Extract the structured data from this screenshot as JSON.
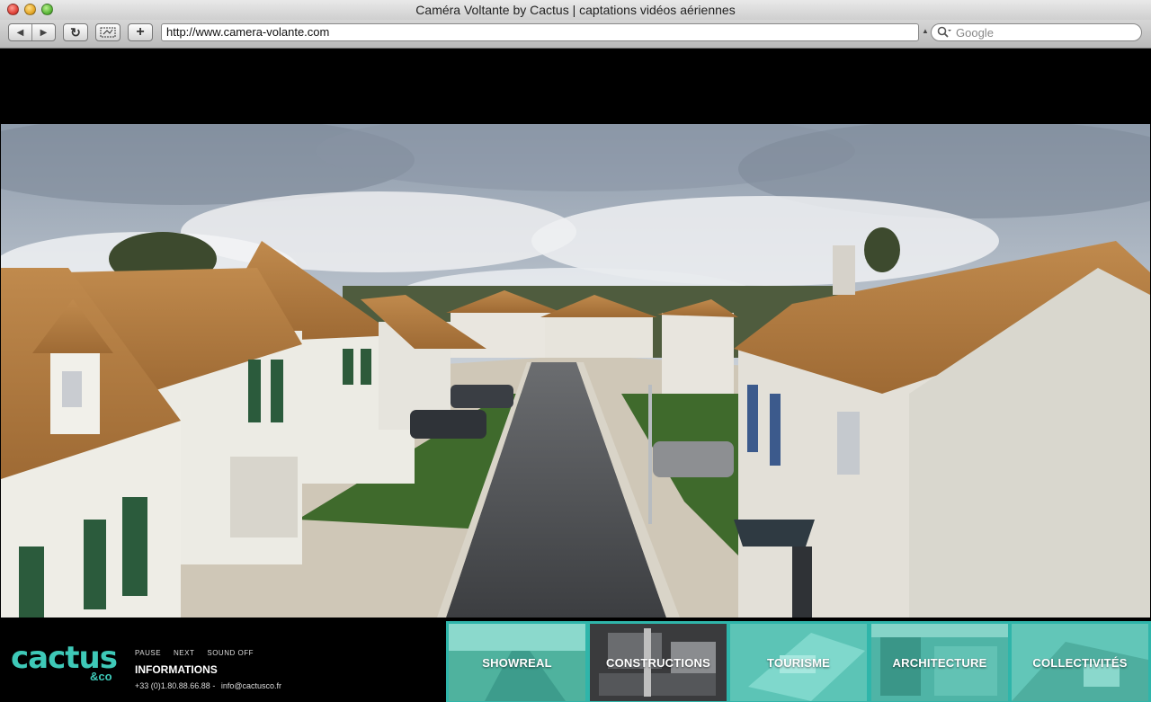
{
  "window": {
    "title": "Caméra Voltante by Cactus | captations vidéos aériennes"
  },
  "toolbar": {
    "back_icon": "◀",
    "forward_icon": "▶",
    "reload_icon": "↻",
    "add_icon": "+",
    "url": "http://www.camera-volante.com",
    "search_placeholder": "Google"
  },
  "brand": {
    "name": "cactus",
    "suffix": "&co",
    "color": "#3ec9b8"
  },
  "controls": {
    "pause": "PAUSE",
    "next": "NEXT",
    "sound": "SOUND OFF"
  },
  "info": {
    "title": "INFORMATIONS",
    "phone": "+33 (0)1.80.88.66.88 -",
    "email": "info@cactusco.fr"
  },
  "categories": [
    {
      "label": "SHOWREAL"
    },
    {
      "label": "CONSTRUCTIONS"
    },
    {
      "label": "TOURISME"
    },
    {
      "label": "ARCHITECTURE"
    },
    {
      "label": "COLLECTIVITÉS"
    }
  ],
  "colors": {
    "accent": "#2fb5aa"
  }
}
